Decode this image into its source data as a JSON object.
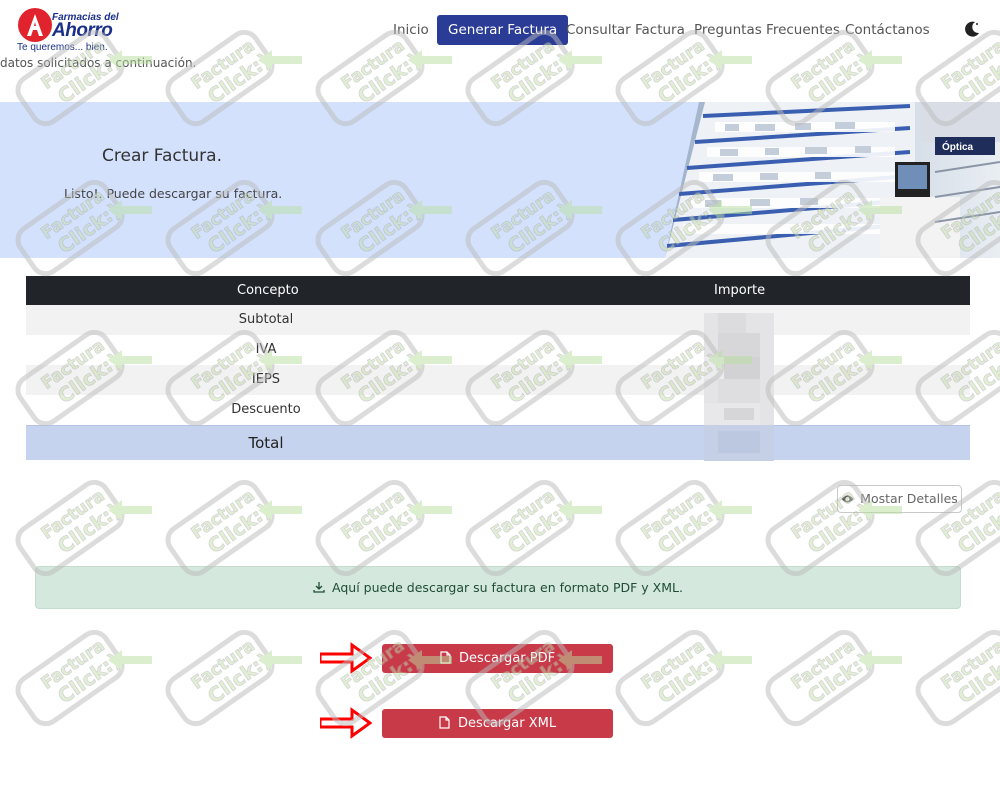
{
  "brand": {
    "line1": "Farmacias del",
    "line2": "Ahorro",
    "tagline": "Te queremos... bien."
  },
  "nav": {
    "items": [
      {
        "label": "Inicio"
      },
      {
        "label": "Generar Factura"
      },
      {
        "label": "Consultar Factura"
      },
      {
        "label": "Preguntas Frecuentes"
      },
      {
        "label": "Contáctanos"
      }
    ],
    "active_index": 1
  },
  "subtext": "datos solicitados a continuación.",
  "hero": {
    "title": "Crear Factura.",
    "message": "Listo!. Puede descargar su factura.",
    "store_sign": "Óptica"
  },
  "table": {
    "headers": [
      "Concepto",
      "Importe"
    ],
    "rows": [
      "Subtotal",
      "IVA",
      "IEPS",
      "Descuento"
    ],
    "total_label": "Total"
  },
  "details_button": "Mostar Detalles",
  "alert": "Aquí puede descargar su factura en formato PDF y XML.",
  "downloads": {
    "pdf_label": "Descargar PDF",
    "xml_label": "Descargar XML"
  },
  "watermark": {
    "line1": "Factura",
    "line2": "Click"
  },
  "colors": {
    "brand_blue": "#2a3c96",
    "brand_red": "#e0232c",
    "hero_bg": "#d3e1fd",
    "table_head": "#212529",
    "total_row": "#c6d3ef",
    "alert_bg": "#d5e8dd",
    "download_button": "#c93a49",
    "annotation_arrow": "#ff0000"
  },
  "icons": [
    "moon-icon",
    "eye-icon",
    "download-icon",
    "file-icon",
    "arrow-right-icon"
  ]
}
